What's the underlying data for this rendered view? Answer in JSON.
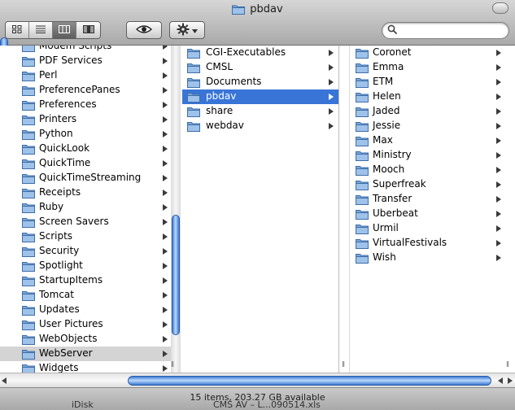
{
  "window": {
    "title": "pbdav"
  },
  "toolbar": {
    "view_buttons": [
      "icon-view-icon",
      "list-view-icon",
      "column-view-icon",
      "coverflow-view-icon"
    ],
    "active_view": 2,
    "search": {
      "value": "",
      "placeholder": ""
    }
  },
  "column1": {
    "items": [
      {
        "label": "Modem Scripts"
      },
      {
        "label": "PDF Services"
      },
      {
        "label": "Perl"
      },
      {
        "label": "PreferencePanes"
      },
      {
        "label": "Preferences"
      },
      {
        "label": "Printers"
      },
      {
        "label": "Python"
      },
      {
        "label": "QuickLook"
      },
      {
        "label": "QuickTime"
      },
      {
        "label": "QuickTimeStreaming"
      },
      {
        "label": "Receipts"
      },
      {
        "label": "Ruby"
      },
      {
        "label": "Screen Savers"
      },
      {
        "label": "Scripts"
      },
      {
        "label": "Security"
      },
      {
        "label": "Spotlight"
      },
      {
        "label": "StartupItems"
      },
      {
        "label": "Tomcat"
      },
      {
        "label": "Updates"
      },
      {
        "label": "User Pictures"
      },
      {
        "label": "WebObjects"
      },
      {
        "label": "WebServer"
      },
      {
        "label": "Widgets"
      }
    ],
    "selected": "WebServer"
  },
  "column2": {
    "items": [
      {
        "label": "CGI-Executables"
      },
      {
        "label": "CMSL"
      },
      {
        "label": "Documents"
      },
      {
        "label": "pbdav"
      },
      {
        "label": "share"
      },
      {
        "label": "webdav"
      }
    ],
    "selected": "pbdav"
  },
  "column3": {
    "items": [
      {
        "label": "Coronet"
      },
      {
        "label": "Emma"
      },
      {
        "label": "ETM"
      },
      {
        "label": "Helen"
      },
      {
        "label": "Jaded"
      },
      {
        "label": "Jessie"
      },
      {
        "label": "Max"
      },
      {
        "label": "Ministry"
      },
      {
        "label": "Mooch"
      },
      {
        "label": "Superfreak"
      },
      {
        "label": "Transfer"
      },
      {
        "label": "Uberbeat"
      },
      {
        "label": "Urmil"
      },
      {
        "label": "VirtualFestivals"
      },
      {
        "label": "Wish"
      }
    ]
  },
  "status": {
    "text": "15 items, 203.27 GB available"
  },
  "behind_window": {
    "left": "iDisk",
    "right": "CMS AV – L...090514.xls"
  },
  "colors": {
    "selection_blue": "#3875d7",
    "selection_gray": "#d4d4d4",
    "folder_blue": "#7aa6d8"
  }
}
